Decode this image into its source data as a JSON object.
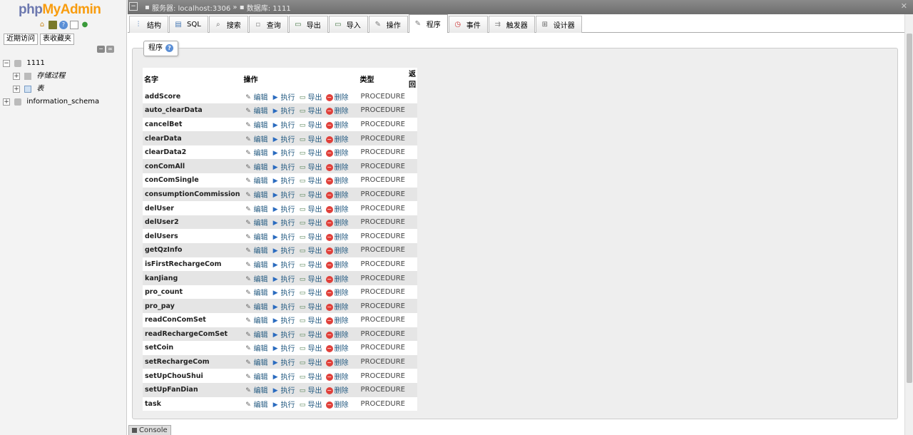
{
  "nav": {
    "logo_php": "php",
    "logo_myadmin": "MyAdmin",
    "icons": [
      "home-icon",
      "settings-icon",
      "help-icon",
      "docs-icon",
      "reload-icon"
    ],
    "tabs": [
      "近期访问",
      "表收藏夹"
    ],
    "tree": [
      {
        "label": "1111",
        "expand": "−"
      },
      {
        "label": "存储过程",
        "expand": "+"
      },
      {
        "label": "表",
        "expand": "+"
      },
      {
        "label": "information_schema",
        "expand": "+"
      }
    ]
  },
  "breadcrumb": {
    "server": "服务器: localhost:3306",
    "separator": "»",
    "database": "数据库: 1111"
  },
  "tabs": [
    {
      "label": "结构",
      "icon": "structure-icon"
    },
    {
      "label": "SQL",
      "icon": "sql-icon"
    },
    {
      "label": "搜索",
      "icon": "search-icon"
    },
    {
      "label": "查询",
      "icon": "query-icon"
    },
    {
      "label": "导出",
      "icon": "export-icon"
    },
    {
      "label": "导入",
      "icon": "import-icon"
    },
    {
      "label": "操作",
      "icon": "operations-icon"
    },
    {
      "label": "程序",
      "icon": "routines-icon",
      "active": true
    },
    {
      "label": "事件",
      "icon": "events-icon"
    },
    {
      "label": "触发器",
      "icon": "triggers-icon"
    },
    {
      "label": "设计器",
      "icon": "designer-icon"
    }
  ],
  "section": {
    "title": "程序"
  },
  "table": {
    "headers": {
      "name": "名字",
      "action": "操作",
      "type": "类型",
      "returns": "返回"
    },
    "actions": {
      "edit": "编辑",
      "execute": "执行",
      "export": "导出",
      "drop": "删除"
    },
    "rows": [
      {
        "name": "addScore",
        "type": "PROCEDURE"
      },
      {
        "name": "auto_clearData",
        "type": "PROCEDURE"
      },
      {
        "name": "cancelBet",
        "type": "PROCEDURE"
      },
      {
        "name": "clearData",
        "type": "PROCEDURE"
      },
      {
        "name": "clearData2",
        "type": "PROCEDURE"
      },
      {
        "name": "conComAll",
        "type": "PROCEDURE"
      },
      {
        "name": "conComSingle",
        "type": "PROCEDURE"
      },
      {
        "name": "consumptionCommission",
        "type": "PROCEDURE"
      },
      {
        "name": "delUser",
        "type": "PROCEDURE"
      },
      {
        "name": "delUser2",
        "type": "PROCEDURE"
      },
      {
        "name": "delUsers",
        "type": "PROCEDURE"
      },
      {
        "name": "getQzInfo",
        "type": "PROCEDURE"
      },
      {
        "name": "isFirstRechargeCom",
        "type": "PROCEDURE"
      },
      {
        "name": "kanJiang",
        "type": "PROCEDURE"
      },
      {
        "name": "pro_count",
        "type": "PROCEDURE"
      },
      {
        "name": "pro_pay",
        "type": "PROCEDURE"
      },
      {
        "name": "readConComSet",
        "type": "PROCEDURE"
      },
      {
        "name": "readRechargeComSet",
        "type": "PROCEDURE"
      },
      {
        "name": "setCoin",
        "type": "PROCEDURE"
      },
      {
        "name": "setRechargeCom",
        "type": "PROCEDURE"
      },
      {
        "name": "setUpChouShui",
        "type": "PROCEDURE"
      },
      {
        "name": "setUpFanDian",
        "type": "PROCEDURE"
      },
      {
        "name": "task",
        "type": "PROCEDURE"
      }
    ]
  },
  "console": {
    "label": "Console"
  },
  "colors": {
    "logo_php": "#6c78af",
    "logo_myadmin": "#f89c0e",
    "drop": "#e0403a"
  }
}
